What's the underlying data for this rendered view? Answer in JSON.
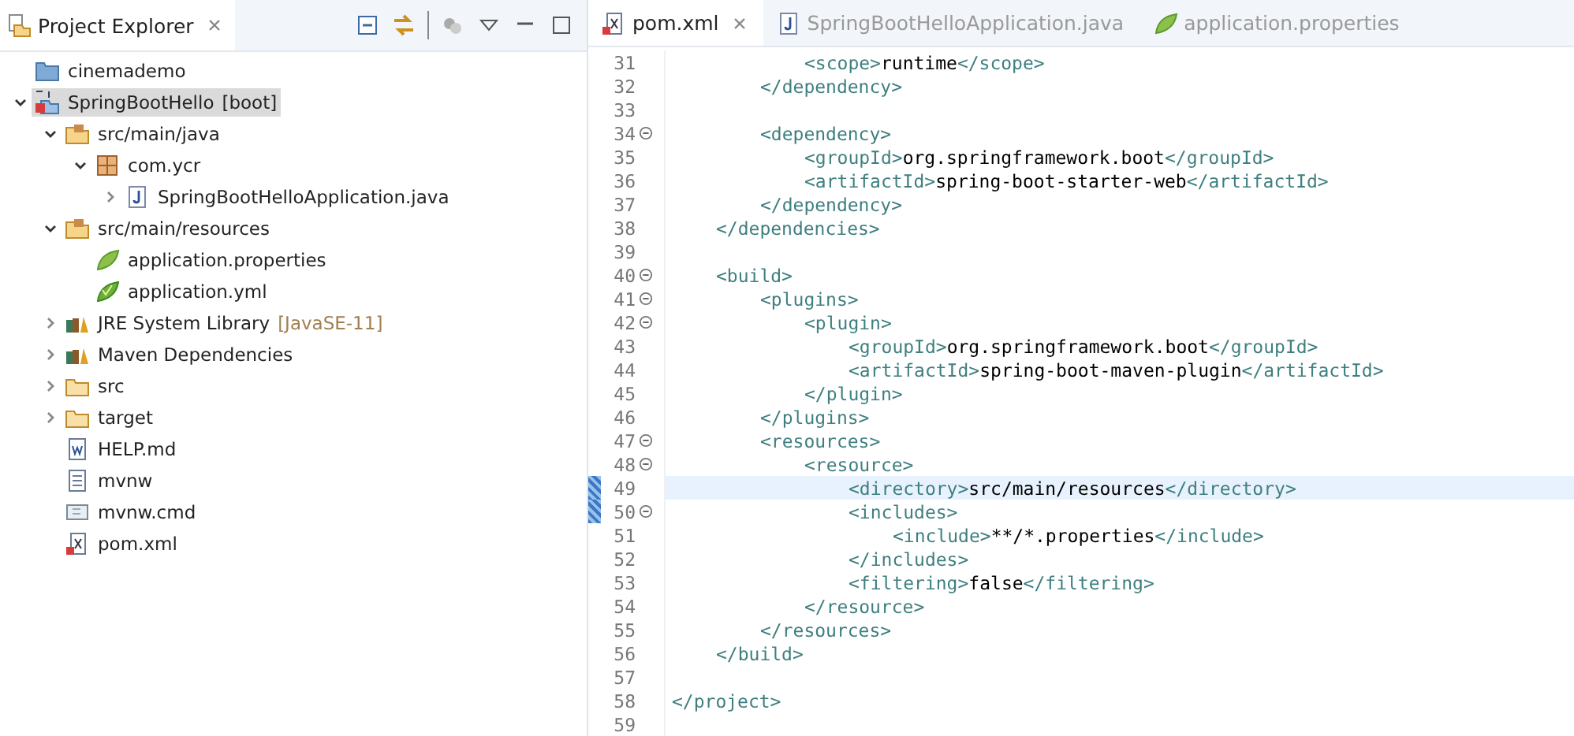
{
  "explorer": {
    "title": "Project Explorer",
    "tree": [
      {
        "label": "cinemademo",
        "kind": "project",
        "selected": false
      },
      {
        "label": "SpringBootHello",
        "suffix": "[boot]",
        "kind": "maven-project",
        "selected": true,
        "expanded": true,
        "children": [
          {
            "label": "src/main/java",
            "kind": "source-folder",
            "selected": false,
            "expanded": true,
            "children": [
              {
                "label": "com.ycr",
                "kind": "package",
                "selected": false,
                "expanded": true,
                "children": [
                  {
                    "label": "SpringBootHelloApplication.java",
                    "kind": "java",
                    "selected": false,
                    "expanded": false
                  }
                ]
              }
            ]
          },
          {
            "label": "src/main/resources",
            "kind": "source-folder",
            "selected": false,
            "expanded": true,
            "children": [
              {
                "label": "application.properties",
                "kind": "leaf",
                "selected": false
              },
              {
                "label": "application.yml",
                "kind": "leaf-yml",
                "selected": false
              }
            ]
          },
          {
            "label": "JRE System Library",
            "suffix": "[JavaSE-11]",
            "kind": "library",
            "selected": false,
            "expanded": false
          },
          {
            "label": "Maven Dependencies",
            "kind": "library",
            "selected": false,
            "expanded": false
          },
          {
            "label": "src",
            "kind": "folder",
            "selected": false,
            "expanded": false
          },
          {
            "label": "target",
            "kind": "folder",
            "selected": false,
            "expanded": false
          },
          {
            "label": "HELP.md",
            "kind": "doc",
            "selected": false
          },
          {
            "label": "mvnw",
            "kind": "text",
            "selected": false
          },
          {
            "label": "mvnw.cmd",
            "kind": "cmd",
            "selected": false
          },
          {
            "label": "pom.xml",
            "kind": "xml",
            "selected": false
          }
        ]
      }
    ]
  },
  "editor": {
    "tabs": [
      {
        "label": "pom.xml",
        "kind": "xml",
        "selected": true
      },
      {
        "label": "SpringBootHelloApplication.java",
        "kind": "java",
        "selected": false
      },
      {
        "label": "application.properties",
        "kind": "leaf",
        "selected": false
      }
    ],
    "lines": [
      {
        "number": "31",
        "text": "\t\t\t<scope>runtime</scope>",
        "fold": false,
        "current": false,
        "marked": false
      },
      {
        "number": "32",
        "text": "\t\t</dependency>",
        "fold": false,
        "current": false,
        "marked": false
      },
      {
        "number": "33",
        "fold": false,
        "current": false,
        "marked": false
      },
      {
        "number": "34",
        "text": "\t\t<dependency>",
        "fold": true,
        "current": false,
        "marked": false
      },
      {
        "number": "35",
        "text": "\t\t\t<groupId>org.springframework.boot</groupId>",
        "fold": false,
        "current": false,
        "marked": false
      },
      {
        "number": "36",
        "text": "\t\t\t<artifactId>spring-boot-starter-web</artifactId>",
        "fold": false,
        "current": false,
        "marked": false
      },
      {
        "number": "37",
        "text": "\t\t</dependency>",
        "fold": false,
        "current": false,
        "marked": false
      },
      {
        "number": "38",
        "text": "\t</dependencies>",
        "fold": false,
        "current": false,
        "marked": false
      },
      {
        "number": "39",
        "fold": false,
        "current": false,
        "marked": false
      },
      {
        "number": "40",
        "text": "\t<build>",
        "fold": true,
        "current": false,
        "marked": false
      },
      {
        "number": "41",
        "text": "\t\t<plugins>",
        "fold": true,
        "current": false,
        "marked": false
      },
      {
        "number": "42",
        "text": "\t\t\t<plugin>",
        "fold": true,
        "current": false,
        "marked": false
      },
      {
        "number": "43",
        "text": "\t\t\t\t<groupId>org.springframework.boot</groupId>",
        "fold": false,
        "current": false,
        "marked": false
      },
      {
        "number": "44",
        "text": "\t\t\t\t<artifactId>spring-boot-maven-plugin</artifactId>",
        "fold": false,
        "current": false,
        "marked": false
      },
      {
        "number": "45",
        "text": "\t\t\t</plugin>",
        "fold": false,
        "current": false,
        "marked": false
      },
      {
        "number": "46",
        "text": "\t\t</plugins>",
        "fold": false,
        "current": false,
        "marked": false
      },
      {
        "number": "47",
        "text": "\t\t<resources>",
        "fold": true,
        "current": false,
        "marked": false
      },
      {
        "number": "48",
        "text": "\t\t\t<resource>",
        "fold": true,
        "current": false,
        "marked": false
      },
      {
        "number": "49",
        "text": "\t\t\t\t<directory>src/main/resources</directory>",
        "fold": false,
        "current": true,
        "marked": true
      },
      {
        "number": "50",
        "text": "\t\t\t\t<includes>",
        "fold": true,
        "current": false,
        "marked": true
      },
      {
        "number": "51",
        "text": "\t\t\t\t\t<include>**/*.properties</include>",
        "fold": false,
        "current": false,
        "marked": false
      },
      {
        "number": "52",
        "text": "\t\t\t\t</includes>",
        "fold": false,
        "current": false,
        "marked": false
      },
      {
        "number": "53",
        "text": "\t\t\t\t<filtering>false</filtering>",
        "fold": false,
        "current": false,
        "marked": false
      },
      {
        "number": "54",
        "text": "\t\t\t</resource>",
        "fold": false,
        "current": false,
        "marked": false
      },
      {
        "number": "55",
        "text": "\t\t</resources>",
        "fold": false,
        "current": false,
        "marked": false
      },
      {
        "number": "56",
        "text": "\t</build>",
        "fold": false,
        "current": false,
        "marked": false
      },
      {
        "number": "57",
        "fold": false,
        "current": false,
        "marked": false
      },
      {
        "number": "58",
        "text": "</project>",
        "fold": false,
        "current": false,
        "marked": false
      },
      {
        "number": "59",
        "fold": false,
        "current": false,
        "marked": false
      }
    ]
  }
}
